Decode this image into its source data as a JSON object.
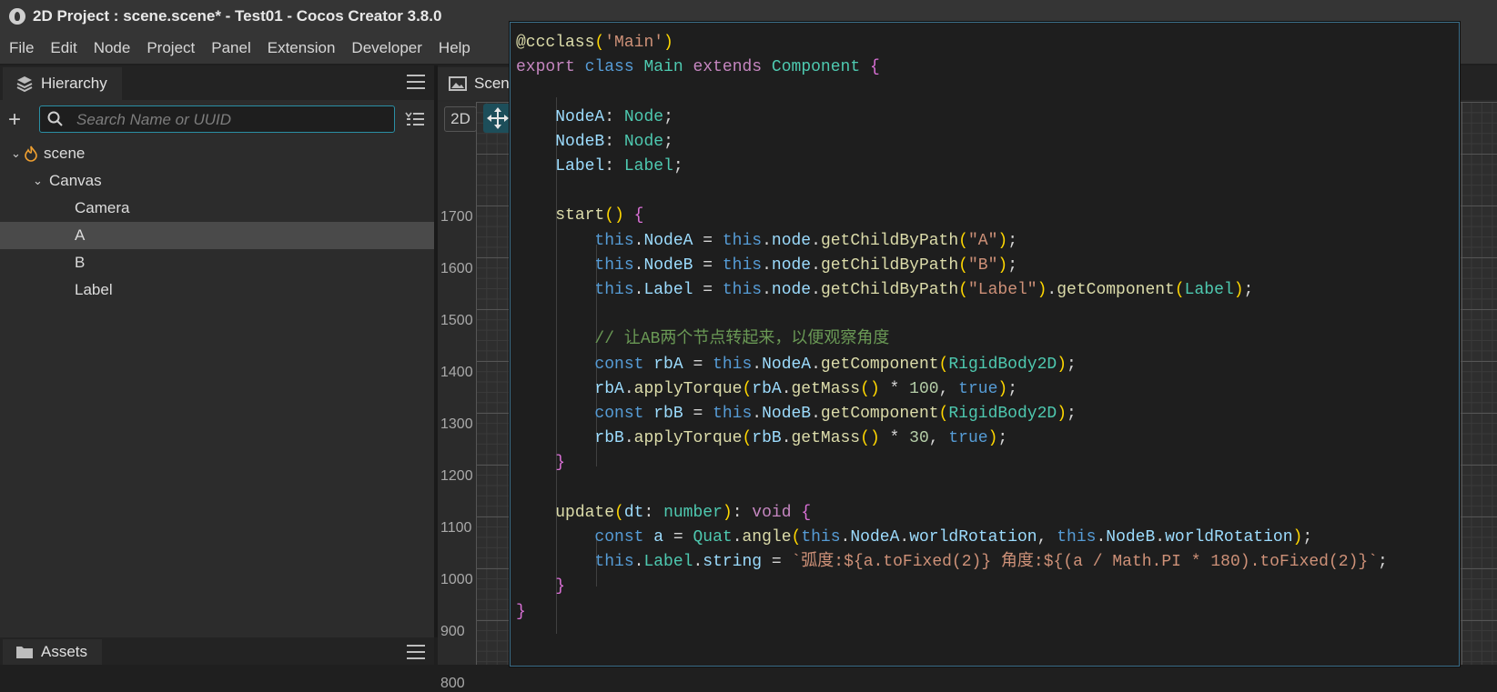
{
  "window": {
    "title": "2D Project : scene.scene* - Test01 - Cocos Creator 3.8.0"
  },
  "menu": [
    "File",
    "Edit",
    "Node",
    "Project",
    "Panel",
    "Extension",
    "Developer",
    "Help"
  ],
  "hierarchy": {
    "tab_label": "Hierarchy",
    "search_placeholder": "Search Name or UUID",
    "tree": [
      {
        "label": "scene",
        "level": 0,
        "expanded": true,
        "icon": "flame-icon"
      },
      {
        "label": "Canvas",
        "level": 1,
        "expanded": true
      },
      {
        "label": "Camera",
        "level": 2
      },
      {
        "label": "A",
        "level": 2,
        "selected": true
      },
      {
        "label": "B",
        "level": 2
      },
      {
        "label": "Label",
        "level": 2
      }
    ]
  },
  "assets": {
    "tab_label": "Assets"
  },
  "scene": {
    "tab_label": "Scen",
    "mode_button": "2D",
    "ruler_labels": [
      "1700",
      "1600",
      "1500",
      "1400",
      "1300",
      "1200",
      "1100",
      "1000",
      "900",
      "800"
    ]
  },
  "code": {
    "lines": [
      "@ccclass('Main')",
      "export class Main extends Component {",
      "",
      "    NodeA: Node;",
      "    NodeB: Node;",
      "    Label: Label;",
      "",
      "    start() {",
      "        this.NodeA = this.node.getChildByPath(\"A\");",
      "        this.NodeB = this.node.getChildByPath(\"B\");",
      "        this.Label = this.node.getChildByPath(\"Label\").getComponent(Label);",
      "",
      "        // 让AB两个节点转起来，以便观察角度",
      "        const rbA = this.NodeA.getComponent(RigidBody2D);",
      "        rbA.applyTorque(rbA.getMass() * 100, true);",
      "        const rbB = this.NodeB.getComponent(RigidBody2D);",
      "        rbB.applyTorque(rbB.getMass() * 30, true);",
      "    }",
      "",
      "    update(dt: number): void {",
      "        const a = Quat.angle(this.NodeA.worldRotation, this.NodeB.worldRotation);",
      "        this.Label.string = `弧度:${a.toFixed(2)} 角度:${(a / Math.PI * 180).toFixed(2)}`;",
      "    }",
      "}"
    ]
  }
}
